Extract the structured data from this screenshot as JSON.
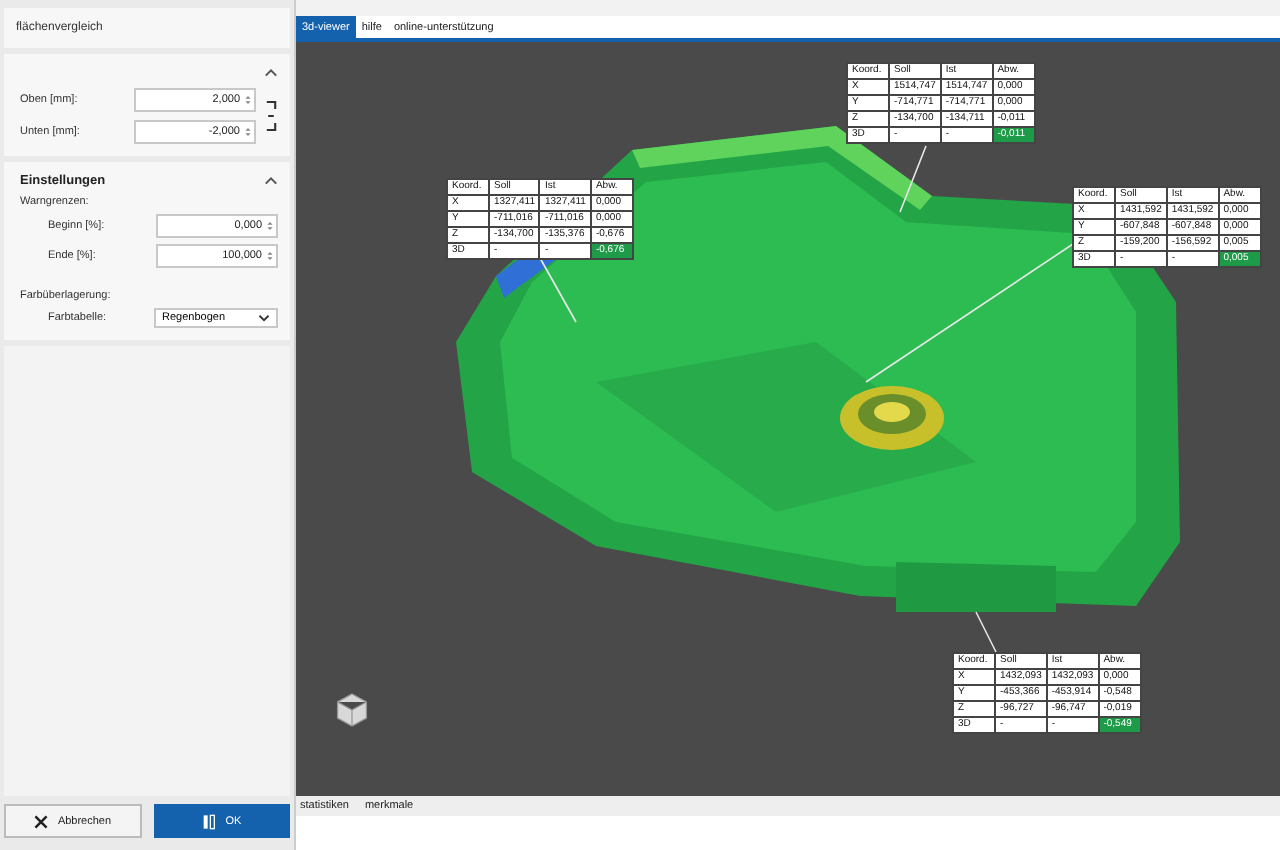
{
  "panel": {
    "title": "flächenvergleich",
    "tolerance_fields": [
      {
        "label": "Oben [mm]:",
        "value": "2,000"
      },
      {
        "label": "Unten [mm]:",
        "value": "-2,000"
      }
    ],
    "settings": {
      "title": "Einstellungen",
      "warn_label": "Warngrenzen:",
      "warn_fields": [
        {
          "label": "Beginn [%]:",
          "value": "0,000"
        },
        {
          "label": "Ende [%]:",
          "value": "100,000"
        }
      ],
      "overlay_label": "Farbüberlagerung:",
      "table_label": "Farbtabelle:",
      "table_value": "Regenbogen"
    },
    "buttons": [
      {
        "label": "Abbrechen",
        "kind": "cancel"
      },
      {
        "label": "OK",
        "kind": "primary"
      }
    ]
  },
  "tabs": [
    {
      "label": "3d-viewer",
      "selected": true
    },
    {
      "label": "hilfe",
      "selected": false
    },
    {
      "label": "online-unterstützung",
      "selected": false
    }
  ],
  "callouts": [
    {
      "header": [
        "Koord.",
        "Soll",
        "Ist",
        "Abw."
      ],
      "rows": [
        [
          "X",
          "1514,747",
          "1514,747",
          "0,000"
        ],
        [
          "Y",
          "-714,771",
          "-714,771",
          "0,000"
        ],
        [
          "Z",
          "-134,700",
          "-134,711",
          "-0,011"
        ],
        [
          "3D",
          "-",
          "-",
          "-0,011"
        ]
      ]
    },
    {
      "header": [
        "Koord.",
        "Soll",
        "Ist",
        "Abw."
      ],
      "rows": [
        [
          "X",
          "1327,411",
          "1327,411",
          "0,000"
        ],
        [
          "Y",
          "-711,016",
          "-711,016",
          "0,000"
        ],
        [
          "Z",
          "-134,700",
          "-135,376",
          "-0,676"
        ],
        [
          "3D",
          "-",
          "-",
          "-0,676"
        ]
      ]
    },
    {
      "header": [
        "Koord.",
        "Soll",
        "Ist",
        "Abw."
      ],
      "rows": [
        [
          "X",
          "1431,592",
          "1431,592",
          "0,000"
        ],
        [
          "Y",
          "-607,848",
          "-607,848",
          "0,000"
        ],
        [
          "Z",
          "-159,200",
          "-156,592",
          "0,005"
        ],
        [
          "3D",
          "-",
          "-",
          "0,005"
        ]
      ]
    },
    {
      "header": [
        "Koord.",
        "Soll",
        "Ist",
        "Abw."
      ],
      "rows": [
        [
          "X",
          "1432,093",
          "1432,093",
          "0,000"
        ],
        [
          "Y",
          "-453,366",
          "-453,914",
          "-0,548"
        ],
        [
          "Z",
          "-96,727",
          "-96,747",
          "-0,019"
        ],
        [
          "3D",
          "-",
          "-",
          "-0,549"
        ]
      ]
    }
  ],
  "bottom_tabs": [
    {
      "label": "statistiken",
      "selected": false
    },
    {
      "label": "merkmale",
      "selected": false
    }
  ]
}
